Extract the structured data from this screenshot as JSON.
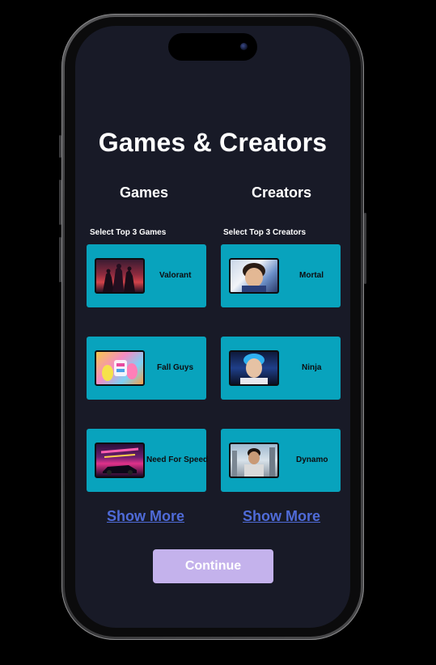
{
  "header": {
    "title": "Games & Creators"
  },
  "games": {
    "heading": "Games",
    "select_label": "Select Top 3 Games",
    "items": [
      {
        "name": "Valorant",
        "thumb": "valorant-thumbnail"
      },
      {
        "name": "Fall Guys",
        "thumb": "fall-guys-thumbnail"
      },
      {
        "name": "Need For Speed",
        "thumb": "need-for-speed-thumbnail"
      }
    ],
    "show_more": "Show More"
  },
  "creators": {
    "heading": "Creators",
    "select_label": "Select Top 3 Creators",
    "items": [
      {
        "name": "Mortal",
        "thumb": "mortal-photo"
      },
      {
        "name": "Ninja",
        "thumb": "ninja-photo"
      },
      {
        "name": "Dynamo",
        "thumb": "dynamo-photo"
      }
    ],
    "show_more": "Show More"
  },
  "actions": {
    "continue_label": "Continue"
  },
  "colors": {
    "background": "#181a27",
    "card": "#08a3bd",
    "link": "#4f6bd8",
    "button": "#c4b2ec"
  }
}
